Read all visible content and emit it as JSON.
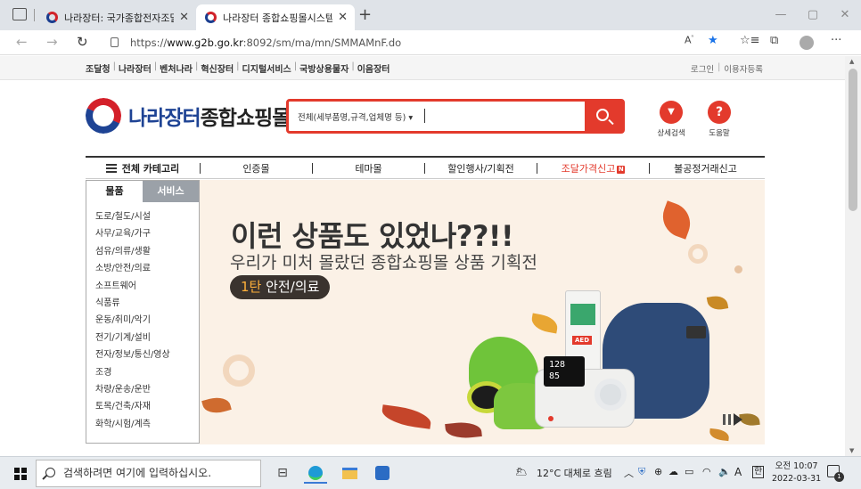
{
  "browser": {
    "tabs": [
      {
        "title": "나라장터: 국가종합전자조달",
        "active": false
      },
      {
        "title": "나라장터 종합쇼핑몰시스템",
        "active": true
      }
    ],
    "url_prefix": "https://",
    "url_host": "www.g2b.go.kr",
    "url_rest": ":8092/sm/ma/mn/SMMAMnF.do"
  },
  "util_links": [
    "조달청",
    "나라장터",
    "벤처나라",
    "혁신장터",
    "디지털서비스",
    "국방상용물자",
    "이음장터"
  ],
  "util_right": [
    "로그인",
    "이용자등록"
  ],
  "logo": {
    "part1": "나라장터",
    "part2": "종합쇼핑몰"
  },
  "search": {
    "scope_label": "전체(세부품명,규격,업체명 등)",
    "caret": "▾"
  },
  "quick_links": [
    {
      "label": "상세검색",
      "icon": "▼"
    },
    {
      "label": "도움말",
      "icon": "?"
    }
  ],
  "gnb": {
    "all_category": "전체 카테고리",
    "items": [
      "인증몰",
      "테마몰",
      "할인행사/기획전",
      "조달가격신고",
      "불공정거래신고"
    ],
    "new_badge": "N"
  },
  "category_tabs": [
    "물품",
    "서비스"
  ],
  "categories": [
    "도로/철도/시설",
    "사무/교육/가구",
    "섬유/의류/생활",
    "소방/안전/의료",
    "소프트웨어",
    "식품류",
    "운동/취미/악기",
    "전기/기계/설비",
    "전자/정보/통신/영상",
    "조경",
    "차량/운송/운반",
    "토목/건축/자재",
    "화학/시험/계측"
  ],
  "banner": {
    "headline": "이런 상품도 있었나??!!",
    "subline": "우리가 미처 몰랐던 종합쇼핑몰 상품 기획전",
    "pill_prefix": "1탄",
    "pill_rest": " 안전/의료",
    "aed_label": "AED",
    "bp_top": "128",
    "bp_bottom": "85"
  },
  "taskbar": {
    "search_placeholder": "검색하려면 여기에 입력하십시오.",
    "weather": "12°C 대체로 흐림",
    "ime": "A",
    "ime2": "한",
    "time_ampm": "오전 10:07",
    "date": "2022-03-31",
    "notif_count": "1"
  },
  "colors": {
    "brand_red": "#e33a2c",
    "brand_blue": "#1e4394",
    "banner_bg": "#fbf1e6"
  }
}
